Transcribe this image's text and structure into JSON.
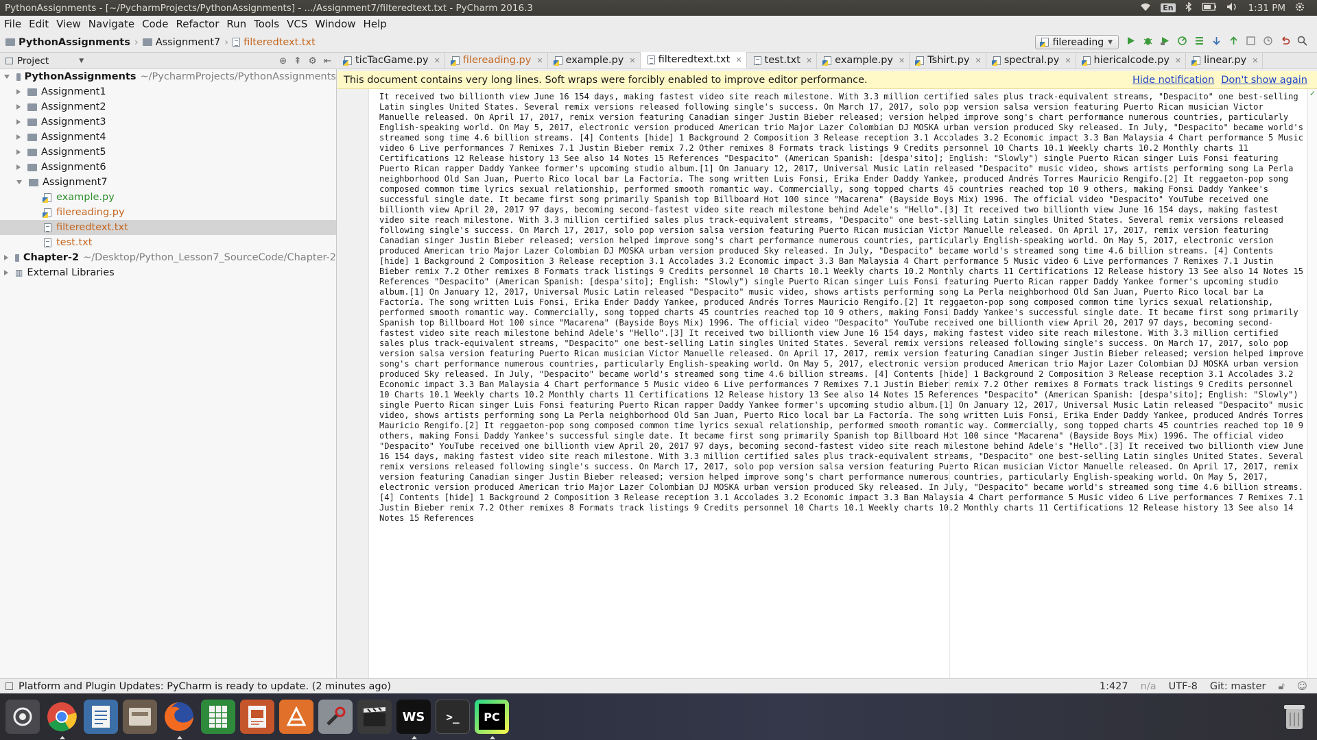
{
  "window": {
    "title": "PythonAssignments - [~/PycharmProjects/PythonAssignments] - .../Assignment7/filteredtext.txt - PyCharm 2016.3"
  },
  "tray": {
    "keyboard": "En",
    "time": "1:31 PM"
  },
  "menu": [
    "File",
    "Edit",
    "View",
    "Navigate",
    "Code",
    "Refactor",
    "Run",
    "Tools",
    "VCS",
    "Window",
    "Help"
  ],
  "breadcrumb": {
    "project": "PythonAssignments",
    "folder": "Assignment7",
    "file": "filteredtext.txt"
  },
  "run_config": "filereading",
  "project_panel": {
    "title": "Project",
    "root_name": "PythonAssignments",
    "root_path": "~/PycharmProjects/PythonAssignments",
    "folders": [
      "Assignment1",
      "Assignment2",
      "Assignment3",
      "Assignment4",
      "Assignment5",
      "Assignment6"
    ],
    "open_folder": "Assignment7",
    "files": [
      "example.py",
      "filereading.py",
      "filteredtext.txt",
      "test.txt"
    ],
    "chapter_name": "Chapter-2",
    "chapter_path": "~/Desktop/Python_Lesson7_SourceCode/Chapter-2",
    "external": "External Libraries"
  },
  "tabs": [
    "ticTacGame.py",
    "filereading.py",
    "example.py",
    "filteredtext.txt",
    "test.txt",
    "example.py",
    "Tshirt.py",
    "spectral.py",
    "hiericalcode.py",
    "linear.py"
  ],
  "notification": {
    "message": "This document contains very long lines. Soft wraps were forcibly enabled to improve editor performance.",
    "hide": "Hide notification",
    "dont_show": "Don't show again"
  },
  "editor_text": "It received two billionth view June 16 154 days, making fastest video site reach milestone. With 3.3 million certified sales plus track-equivalent streams, \"Despacito\" one best-selling Latin singles United States. Several remix versions released following single's success. On March 17, 2017, solo pop version salsa version featuring Puerto Rican musician Victor Manuelle released. On April 17, 2017, remix version featuring Canadian singer Justin Bieber released; version helped improve song's chart performance numerous countries, particularly English-speaking world. On May 5, 2017, electronic version produced American trio Major Lazer Colombian DJ MOSKA urban version produced Sky released. In July, \"Despacito\" became world's streamed song time 4.6 billion streams. [4] Contents [hide] 1 Background 2 Composition 3 Release reception 3.1 Accolades 3.2 Economic impact 3.3 Ban Malaysia 4 Chart performance 5 Music video 6 Live performances 7 Remixes 7.1 Justin Bieber remix 7.2 Other remixes 8 Formats track listings 9 Credits personnel 10 Charts 10.1 Weekly charts 10.2 Monthly charts 11 Certifications 12 Release history 13 See also 14 Notes 15 References \"Despacito\" (American Spanish: [despa'sito]; English: \"Slowly\") single Puerto Rican singer Luis Fonsi featuring Puerto Rican rapper Daddy Yankee former's upcoming studio album.[1] On January 12, 2017, Universal Music Latin released \"Despacito\" music video, shows artists performing song La Perla neighborhood Old San Juan, Puerto Rico local bar La Factoría. The song written Luis Fonsi, Erika Ender Daddy Yankee, produced Andrés Torres Mauricio Rengifo.[2] It reggaeton-pop song composed common time lyrics sexual relationship, performed smooth romantic way. Commercially, song topped charts 45 countries reached top 10 9 others, making Fonsi Daddy Yankee's successful single date. It became first song primarily Spanish top Billboard Hot 100 since \"Macarena\" (Bayside Boys Mix) 1996. The official video \"Despacito\" YouTube received one billionth view April 20, 2017 97 days, becoming second-fastest video site reach milestone behind Adele's \"Hello\".[3] It received two billionth view June 16 154 days, making fastest video site reach milestone. With 3.3 million certified sales plus track-equivalent streams, \"Despacito\" one best-selling Latin singles United States. Several remix versions released following single's success. On March 17, 2017, solo pop version salsa version featuring Puerto Rican musician Victor Manuelle released. On April 17, 2017, remix version featuring Canadian singer Justin Bieber released; version helped improve song's chart performance numerous countries, particularly English-speaking world. On May 5, 2017, electronic version produced American trio Major Lazer Colombian DJ MOSKA urban version produced Sky released. In July, \"Despacito\" became world's streamed song time 4.6 billion streams. [4] Contents [hide] 1 Background 2 Composition 3 Release reception 3.1 Accolades 3.2 Economic impact 3.3 Ban Malaysia 4 Chart performance 5 Music video 6 Live performances 7 Remixes 7.1 Justin Bieber remix 7.2 Other remixes 8 Formats track listings 9 Credits personnel 10 Charts 10.1 Weekly charts 10.2 Monthly charts 11 Certifications 12 Release history 13 See also 14 Notes 15 References \"Despacito\" (American Spanish: [despa'sito]; English: \"Slowly\") single Puerto Rican singer Luis Fonsi featuring Puerto Rican rapper Daddy Yankee former's upcoming studio album.[1] On January 12, 2017, Universal Music Latin released \"Despacito\" music video, shows artists performing song La Perla neighborhood Old San Juan, Puerto Rico local bar La Factoría. The song written Luis Fonsi, Erika Ender Daddy Yankee, produced Andrés Torres Mauricio Rengifo.[2] It reggaeton-pop song composed common time lyrics sexual relationship, performed smooth romantic way. Commercially, song topped charts 45 countries reached top 10 9 others, making Fonsi Daddy Yankee's successful single date. It became first song primarily Spanish top Billboard Hot 100 since \"Macarena\" (Bayside Boys Mix) 1996. The official video \"Despacito\" YouTube received one billionth view April 20, 2017 97 days, becoming second-fastest video site reach milestone behind Adele's \"Hello\".[3] It received two billionth view June 16 154 days, making fastest video site reach milestone. With 3.3 million certified sales plus track-equivalent streams, \"Despacito\" one best-selling Latin singles United States. Several remix versions released following single's success. On March 17, 2017, solo pop version salsa version featuring Puerto Rican musician Victor Manuelle released. On April 17, 2017, remix version featuring Canadian singer Justin Bieber released; version helped improve song's chart performance numerous countries, particularly English-speaking world. On May 5, 2017, electronic version produced American trio Major Lazer Colombian DJ MOSKA urban version produced Sky released. In July, \"Despacito\" became world's streamed song time 4.6 billion streams. [4] Contents [hide] 1 Background 2 Composition 3 Release reception 3.1 Accolades 3.2 Economic impact 3.3 Ban Malaysia 4 Chart performance 5 Music video 6 Live performances 7 Remixes 7.1 Justin Bieber remix 7.2 Other remixes 8 Formats track listings 9 Credits personnel 10 Charts 10.1 Weekly charts 10.2 Monthly charts 11 Certifications 12 Release history 13 See also 14 Notes 15 References \"Despacito\" (American Spanish: [despa'sito]; English: \"Slowly\") single Puerto Rican singer Luis Fonsi featuring Puerto Rican rapper Daddy Yankee former's upcoming studio album.[1] On January 12, 2017, Universal Music Latin released \"Despacito\" music video, shows artists performing song La Perla neighborhood Old San Juan, Puerto Rico local bar La Factoría. The song written Luis Fonsi, Erika Ender Daddy Yankee, produced Andrés Torres Mauricio Rengifo.[2] It reggaeton-pop song composed common time lyrics sexual relationship, performed smooth romantic way. Commercially, song topped charts 45 countries reached top 10 9 others, making Fonsi Daddy Yankee's successful single date. It became first song primarily Spanish top Billboard Hot 100 since \"Macarena\" (Bayside Boys Mix) 1996. The official video \"Despacito\" YouTube received one billionth view April 20, 2017 97 days, becoming second-fastest video site reach milestone behind Adele's \"Hello\".[3] It received two billionth view June 16 154 days, making fastest video site reach milestone. With 3.3 million certified sales plus track-equivalent streams, \"Despacito\" one best-selling Latin singles United States. Several remix versions released following single's success. On March 17, 2017, solo pop version salsa version featuring Puerto Rican musician Victor Manuelle released. On April 17, 2017, remix version featuring Canadian singer Justin Bieber released; version helped improve song's chart performance numerous countries, particularly English-speaking world. On May 5, 2017, electronic version produced American trio Major Lazer Colombian DJ MOSKA urban version produced Sky released. In July, \"Despacito\" became world's streamed song time 4.6 billion streams. [4] Contents [hide] 1 Background 2 Composition 3 Release reception 3.1 Accolades 3.2 Economic impact 3.3 Ban Malaysia 4 Chart performance 5 Music video 6 Live performances 7 Remixes 7.1 Justin Bieber remix 7.2 Other remixes 8 Formats track listings 9 Credits personnel 10 Charts 10.1 Weekly charts 10.2 Monthly charts 11 Certifications 12 Release history 13 See also 14 Notes 15 References",
  "status": {
    "message": "Platform and Plugin Updates: PyCharm is ready to update. (2 minutes ago)",
    "position": "1:427",
    "na": "n/a",
    "encoding": "UTF-8",
    "git": "Git: master"
  },
  "dock_labels": {
    "webstorm": "WS",
    "pycharm": "PC"
  }
}
